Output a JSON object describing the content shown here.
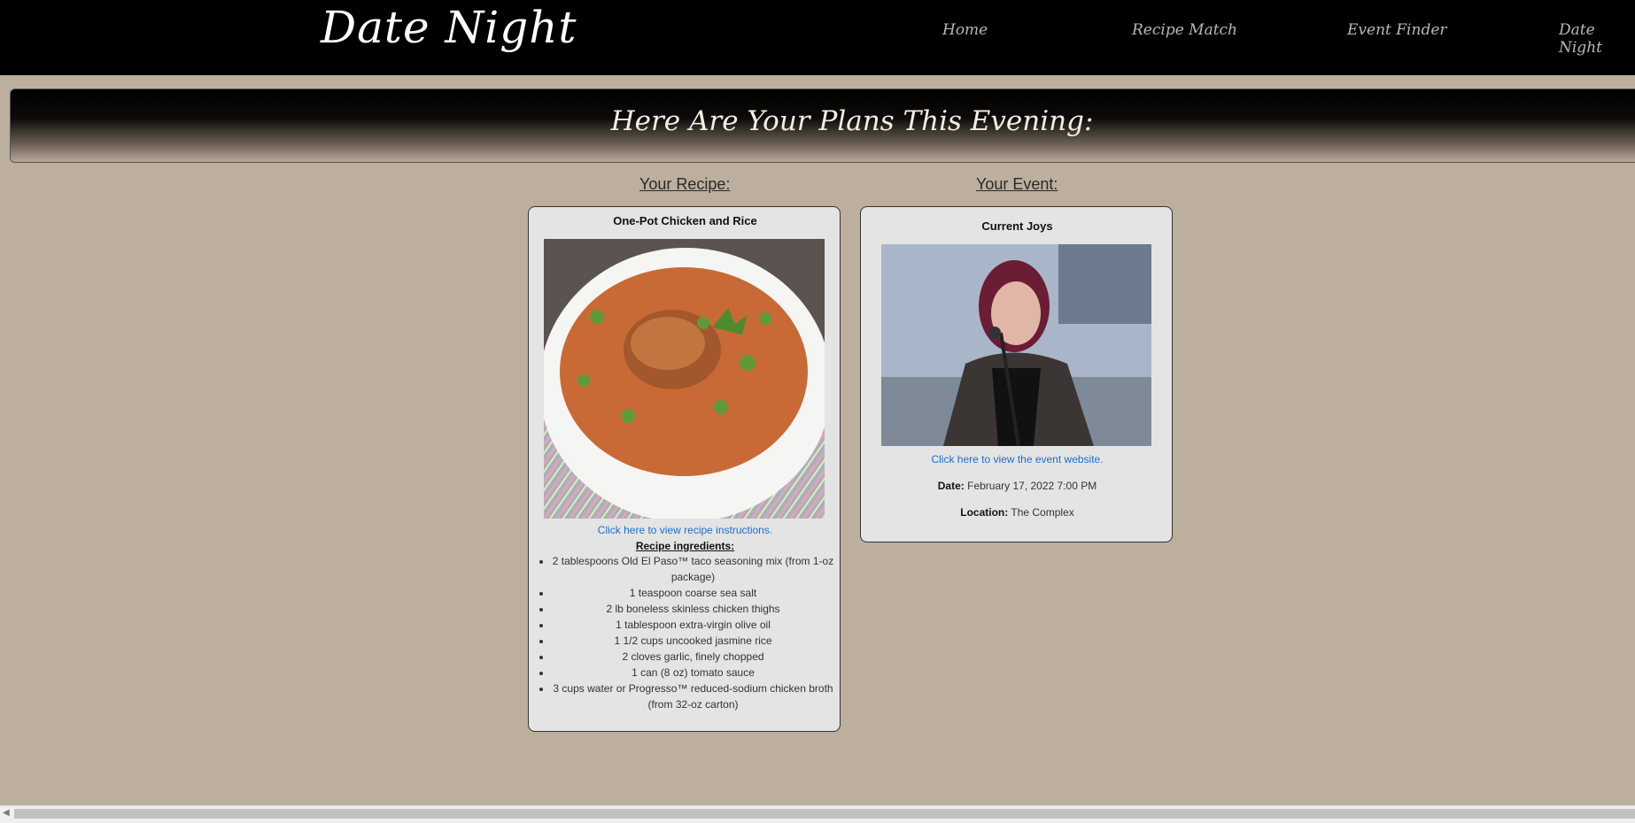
{
  "nav": {
    "logo": "Date Night",
    "links": [
      "Home",
      "Recipe Match",
      "Event Finder",
      "Date Night"
    ]
  },
  "banner": {
    "title": "Here Are Your Plans This Evening:"
  },
  "recipe": {
    "heading": "Your Recipe:",
    "name": "One-Pot Chicken and Rice",
    "link_text": "Click here to view recipe instructions.",
    "ingredients_heading": "Recipe ingredients:",
    "ingredients": [
      "2 tablespoons Old El Paso™ taco seasoning mix (from 1-oz package)",
      "1 teaspoon coarse sea salt",
      "2 lb boneless skinless chicken thighs",
      "1 tablespoon extra-virgin olive oil",
      "1 1/2 cups uncooked jasmine rice",
      "2 cloves garlic, finely chopped",
      "1 can (8 oz) tomato sauce",
      "3 cups water or Progresso™ reduced-sodium chicken broth (from 32-oz carton)"
    ]
  },
  "event": {
    "heading": "Your Event:",
    "name": "Current Joys",
    "link_text": "Click here to view the event website.",
    "date_label": "Date:",
    "date_value": "February 17, 2022 7:00 PM",
    "location_label": "Location:",
    "location_value": "The Complex"
  },
  "colors": {
    "page_bg": "#bcaf9e",
    "nav_bg": "#000000",
    "card_bg": "#e4e4e4",
    "link": "#1a6ed0"
  }
}
